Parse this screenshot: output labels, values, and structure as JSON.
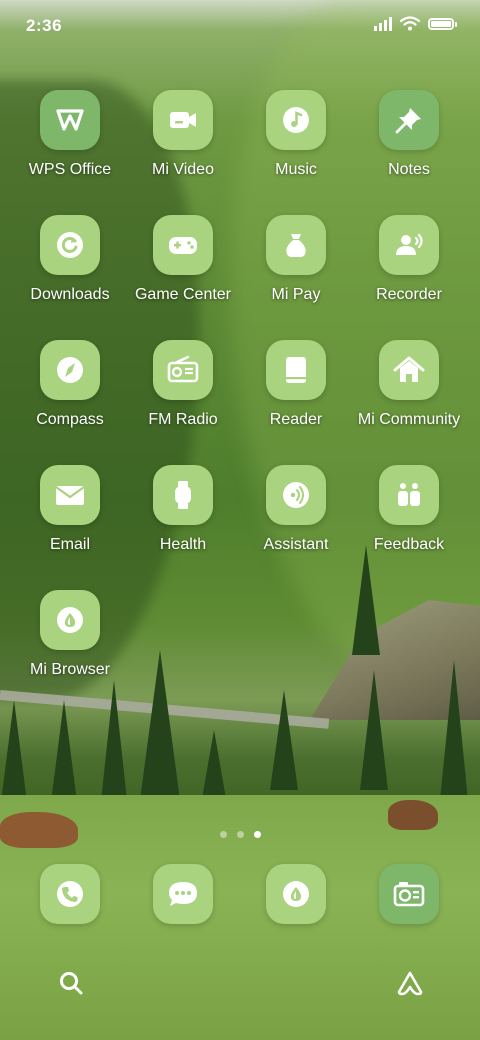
{
  "status_bar": {
    "time": "2:36",
    "icons": [
      "signal-icon",
      "wifi-icon",
      "battery-icon"
    ],
    "battery_level": 0.9
  },
  "apps": [
    {
      "label": "WPS Office",
      "icon": "wps-icon"
    },
    {
      "label": "Mi Video",
      "icon": "video-camera-icon"
    },
    {
      "label": "Music",
      "icon": "music-note-icon"
    },
    {
      "label": "Notes",
      "icon": "pin-icon"
    },
    {
      "label": "Downloads",
      "icon": "download-icon"
    },
    {
      "label": "Game Center",
      "icon": "gamepad-icon"
    },
    {
      "label": "Mi Pay",
      "icon": "money-bag-icon"
    },
    {
      "label": "Recorder",
      "icon": "recorder-icon"
    },
    {
      "label": "Compass",
      "icon": "compass-icon"
    },
    {
      "label": "FM Radio",
      "icon": "radio-icon"
    },
    {
      "label": "Reader",
      "icon": "book-icon"
    },
    {
      "label": "Mi Community",
      "icon": "home-icon"
    },
    {
      "label": "Email",
      "icon": "envelope-icon"
    },
    {
      "label": "Health",
      "icon": "watch-icon"
    },
    {
      "label": "Assistant",
      "icon": "assistant-icon"
    },
    {
      "label": "Feedback",
      "icon": "feedback-icon"
    },
    {
      "label": "Mi Browser",
      "icon": "browser-icon"
    }
  ],
  "page_indicator": {
    "pages": 3,
    "current": 3
  },
  "dock": [
    {
      "icon": "phone-icon"
    },
    {
      "icon": "messages-icon"
    },
    {
      "icon": "browser-icon"
    },
    {
      "icon": "camera-icon"
    }
  ],
  "bottom_bar": {
    "left": "search-icon",
    "right": "app-vault-icon"
  },
  "colors": {
    "icon_background": "#a9d37e",
    "icon_background_dark": "#7eb76a",
    "label_text": "#ffffff"
  }
}
